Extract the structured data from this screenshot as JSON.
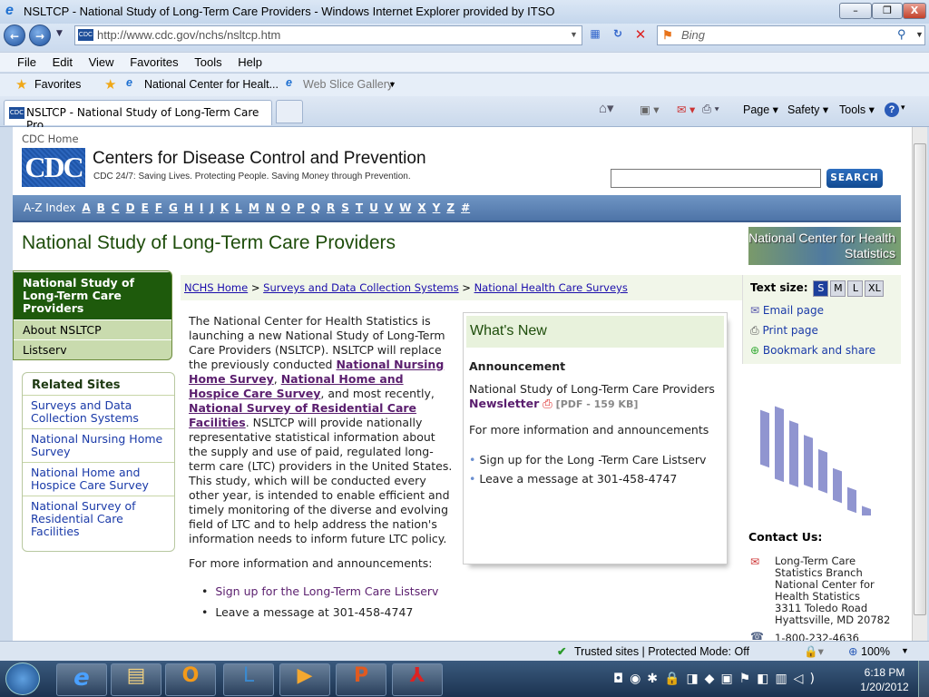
{
  "window": {
    "title": "NSLTCP - National Study of Long-Term Care Providers - Windows Internet Explorer provided by ITSO",
    "minimize": "–",
    "restore": "❐",
    "close": "X"
  },
  "nav": {
    "url": "http://www.cdc.gov/nchs/nsltcp.htm",
    "search_placeholder": "Bing"
  },
  "menu": [
    "File",
    "Edit",
    "View",
    "Favorites",
    "Tools",
    "Help"
  ],
  "favorites": {
    "label": "Favorites",
    "items": [
      "National Center for Healt...",
      "Web Slice Gallery"
    ]
  },
  "tab": {
    "title": "NSLTCP - National Study of Long-Term Care Pro..."
  },
  "commands": {
    "page": "Page",
    "safety": "Safety",
    "tools": "Tools"
  },
  "cdc": {
    "home": "CDC Home",
    "logo": "CDC",
    "name": "Centers for Disease Control and Prevention",
    "tagline": "CDC 24/7: Saving Lives. Protecting People. Saving Money through Prevention.",
    "search_button": "SEARCH",
    "search_value": ""
  },
  "az": {
    "label": "A-Z Index",
    "letters": [
      "A",
      "B",
      "C",
      "D",
      "E",
      "F",
      "G",
      "H",
      "I",
      "J",
      "K",
      "L",
      "M",
      "N",
      "O",
      "P",
      "Q",
      "R",
      "S",
      "T",
      "U",
      "V",
      "W",
      "X",
      "Y",
      "Z",
      "#"
    ]
  },
  "page_title": "National Study of Long-Term Care Providers",
  "nchs_logo": "National Center for Health Statistics",
  "leftnav": {
    "active": "National Study of Long-Term Care Providers",
    "items": [
      "About NSLTCP",
      "Listserv"
    ]
  },
  "related": {
    "title": "Related Sites",
    "items": [
      "Surveys and Data Collection Systems",
      "National Nursing Home Survey",
      "National Home and Hospice Care Survey",
      "National Survey of Residential Care Facilities"
    ]
  },
  "breadcrumb": {
    "items": [
      "NCHS Home",
      "Surveys and Data Collection Systems",
      "National Health Care Surveys"
    ],
    "sep": ">"
  },
  "body": {
    "p1a": "The National Center for Health Statistics is launching a new National Study of Long-Term Care Providers (NSLTCP).  NSLTCP will replace the previously conducted ",
    "l1": "National Nursing Home Survey",
    "c1": ", ",
    "l2": "National Home and Hospice Care Survey",
    "c2": ", and most recently, ",
    "l3": "National Survey of Residential Care Facilities",
    "p1b": ". NSLTCP will provide nationally representative statistical information about the supply and use of paid, regulated long-term care (LTC) providers in the United States. This study, which will be conducted every other year, is intended to enable efficient and timely monitoring of the diverse and evolving field of LTC and to help address the nation's information needs to inform future LTC policy.",
    "more": "For more information and announcements:",
    "bullets": [
      "Sign up for the Long-Term Care Listserv",
      "Leave a message at 301-458-4747"
    ]
  },
  "whatsnew": {
    "title": "What's New",
    "heading": "Announcement",
    "text": "National Study of Long-Term Care Providers",
    "newsletter": "Newsletter",
    "pdf": "[PDF - 159 KB]",
    "more": "For more information and announcements",
    "bullets": [
      "Sign up for the Long -Term Care Listserv",
      "Leave a message at 301-458-4747"
    ]
  },
  "tools": {
    "text_size": "Text size:",
    "sizes": [
      "S",
      "M",
      "L",
      "XL"
    ],
    "email": "Email page",
    "print": "Print page",
    "bookmark": "Bookmark and share"
  },
  "contact": {
    "title": "Contact Us:",
    "lines": [
      "Long-Term Care",
      "Statistics Branch",
      "National Center for",
      "Health Statistics",
      "3311 Toledo Road",
      "Hyattsville, MD 20782"
    ],
    "phone": "1-800-232-4636"
  },
  "status": {
    "zone": "Trusted sites | Protected Mode: Off",
    "zoom": "100%"
  },
  "clock": {
    "time": "6:18 PM",
    "date": "1/20/2012"
  }
}
